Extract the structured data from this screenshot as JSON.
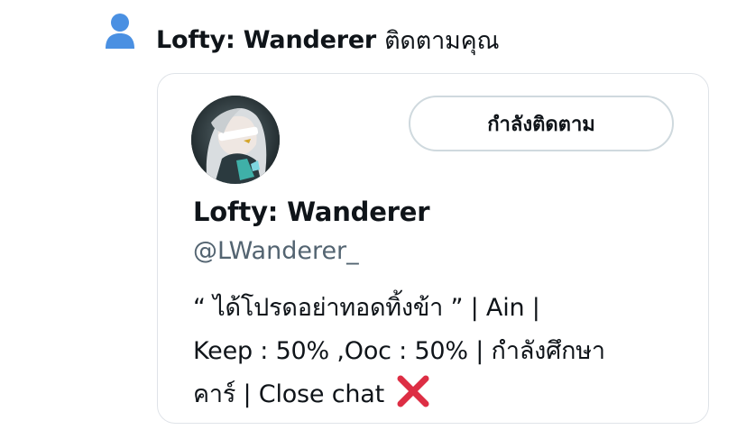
{
  "notification": {
    "icon": "person-icon",
    "icon_color": "#4a90e2",
    "user_name": "Lofty: Wanderer",
    "action_text": "ติดตามคุณ"
  },
  "profile_card": {
    "avatar": "avatar-image",
    "follow_button_label": "กำลังติดตาม",
    "display_name": "Lofty: Wanderer",
    "handle": "@LWanderer_",
    "bio": {
      "line1": "“ ได้โปรดอย่าทอดทิ้งข้า ” | Ain |",
      "line2": "Keep : 50% ,Ooc : 50% | กำลังศึกษา",
      "line3": "คาร์ | Close chat",
      "emoji": "cross-mark-icon"
    }
  },
  "colors": {
    "text_primary": "#0f1419",
    "text_secondary": "#536471",
    "border": "#dfe3e8",
    "cross_red": "#dd2e44"
  }
}
